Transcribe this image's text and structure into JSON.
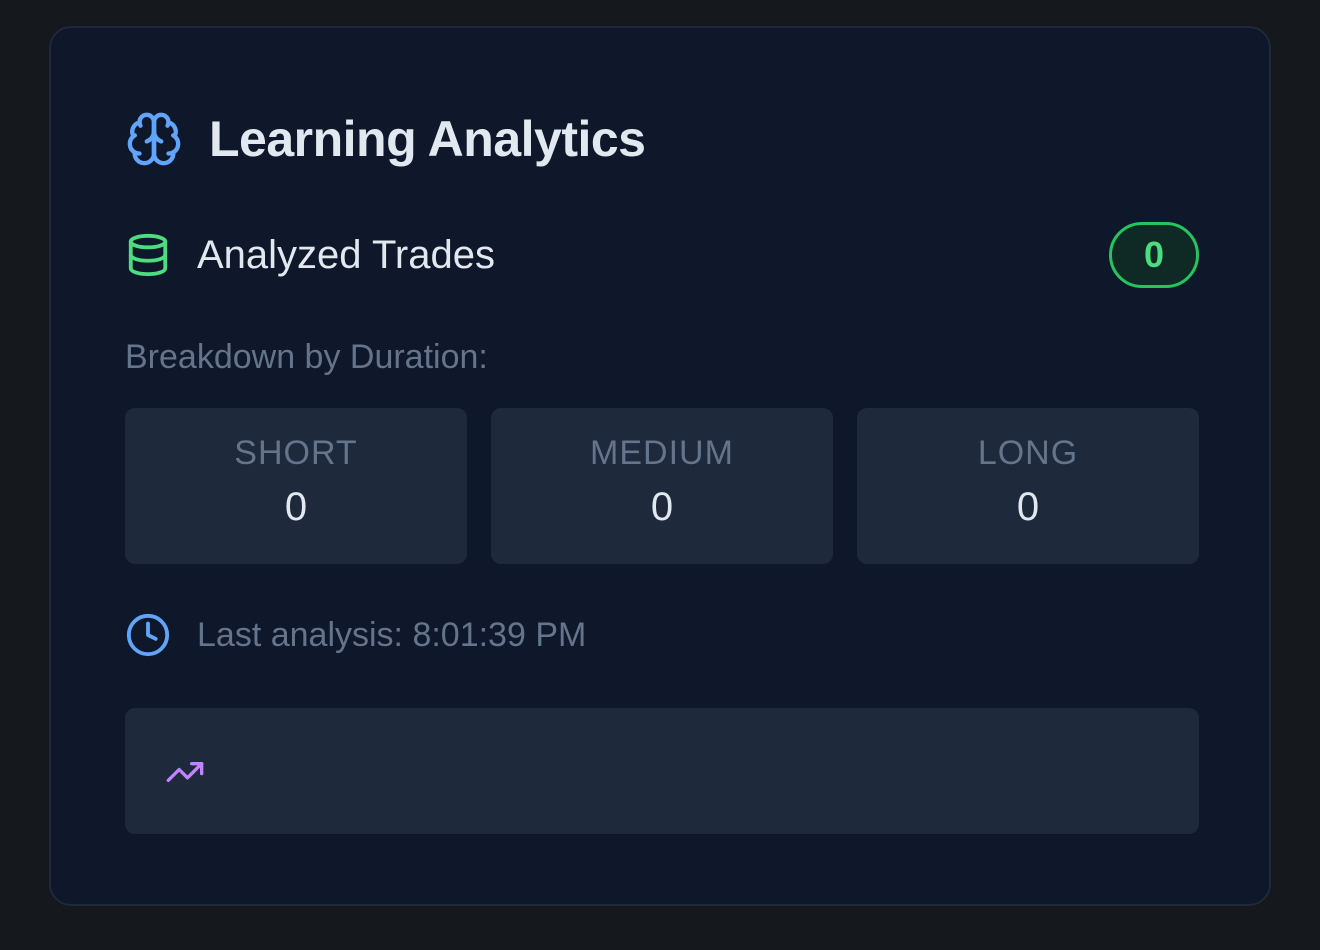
{
  "card": {
    "title": "Learning Analytics",
    "title_icon": "brain-icon"
  },
  "trades": {
    "label": "Analyzed Trades",
    "icon": "database-icon",
    "count": "0"
  },
  "breakdown": {
    "label": "Breakdown by Duration:",
    "items": [
      {
        "name": "SHORT",
        "value": "0"
      },
      {
        "name": "MEDIUM",
        "value": "0"
      },
      {
        "name": "LONG",
        "value": "0"
      }
    ]
  },
  "last_analysis": {
    "icon": "clock-icon",
    "text": "Last analysis: 8:01:39 PM"
  },
  "insight": {
    "icon": "trending-up-icon"
  },
  "colors": {
    "page_bg": "#15181c",
    "card_bg": "#0f172a",
    "panel_bg": "#1e293b",
    "accent_blue": "#60a5fa",
    "accent_green": "#4ade80",
    "accent_purple": "#c084fc",
    "muted_text": "#64748b",
    "primary_text": "#e2e8f0"
  }
}
